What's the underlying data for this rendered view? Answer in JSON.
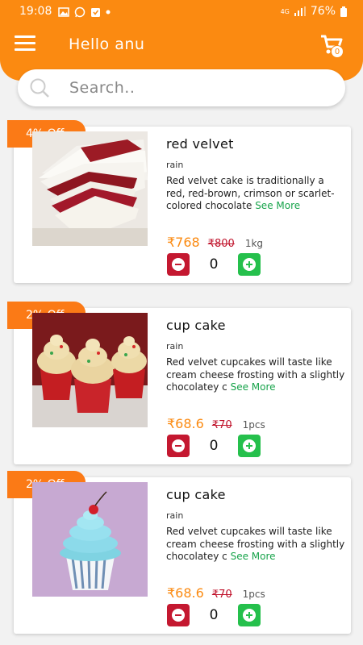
{
  "status": {
    "time": "19:08",
    "network": "4G",
    "battery": "76%"
  },
  "header": {
    "greeting": "Hello anu",
    "cart_count": "0"
  },
  "search": {
    "placeholder": "Search.."
  },
  "products": [
    {
      "badge": "4% Off",
      "title": "red velvet",
      "sub": "rain",
      "desc": "Red velvet cake is traditionally a red, red-brown, crimson or scarlet-colored chocolate",
      "see_more": "See More",
      "price": "₹768",
      "mrp": "₹800",
      "unit": "1kg",
      "qty": "0"
    },
    {
      "badge": "2% Off",
      "title": "cup cake",
      "sub": "rain",
      "desc": "Red velvet cupcakes will taste like cream cheese frosting with a slightly chocolatey c",
      "see_more": "See More",
      "price": "₹68.6",
      "mrp": "₹70",
      "unit": "1pcs",
      "qty": "0"
    },
    {
      "badge": "2% Off",
      "title": "cup cake",
      "sub": "rain",
      "desc": "Red velvet cupcakes will taste like cream cheese frosting with a slightly chocolatey c",
      "see_more": "See More",
      "price": "₹68.6",
      "mrp": "₹70",
      "unit": "1pcs",
      "qty": "0"
    }
  ]
}
